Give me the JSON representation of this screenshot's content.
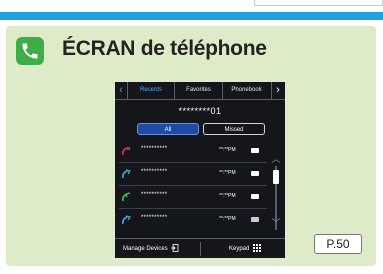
{
  "header": {
    "title": "ÉCRAN de téléphone",
    "accent_color": "#1ea1dc",
    "icon": "phone-icon"
  },
  "screen": {
    "tabs": [
      {
        "label": "Recents",
        "active": true
      },
      {
        "label": "Favorites",
        "active": false
      },
      {
        "label": "Phonebook",
        "active": false
      }
    ],
    "number": "********01",
    "filters": [
      {
        "label": "All",
        "selected": true
      },
      {
        "label": "Missed",
        "selected": false
      }
    ],
    "calls": [
      {
        "type": "missed",
        "name": "**********",
        "time": "**:**PM"
      },
      {
        "type": "outgoing",
        "name": "**********",
        "time": "**:**PM"
      },
      {
        "type": "incoming",
        "name": "**********",
        "time": "**:**PM"
      },
      {
        "type": "outgoing",
        "name": "**********",
        "time": "**:**PM"
      }
    ],
    "bottom": {
      "manage_label": "Manage Devices",
      "keypad_label": "Keypad"
    }
  },
  "page_ref": "P.50"
}
